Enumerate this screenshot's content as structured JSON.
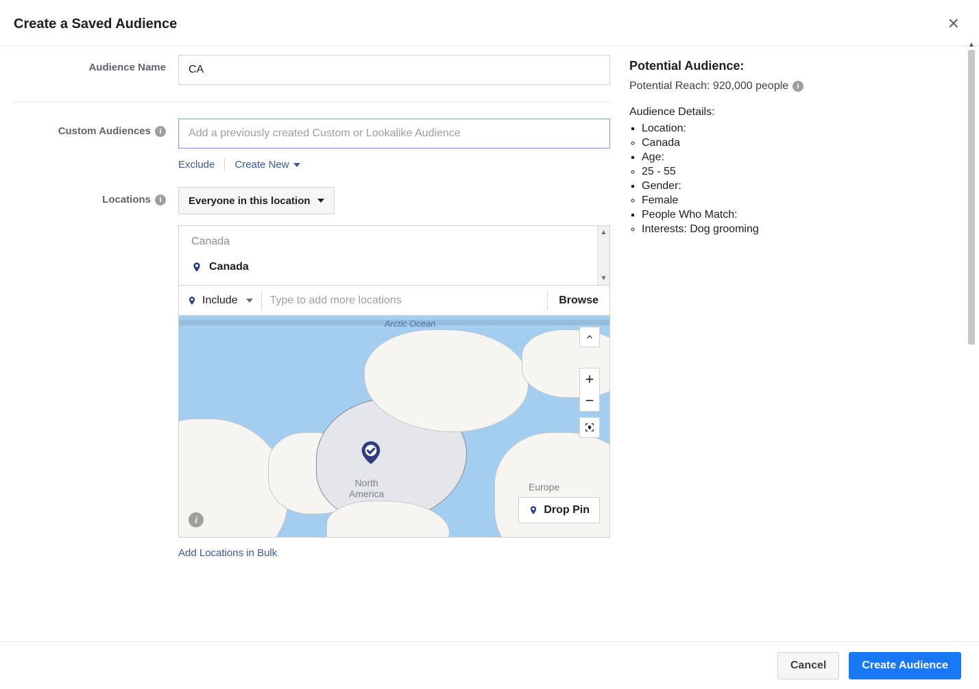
{
  "header": {
    "title": "Create a Saved Audience"
  },
  "labels": {
    "audience_name": "Audience Name",
    "custom_audiences": "Custom Audiences",
    "locations": "Locations"
  },
  "audience_name": {
    "value": "CA"
  },
  "custom_audiences": {
    "placeholder": "Add a previously created Custom or Lookalike Audience",
    "exclude": "Exclude",
    "create_new": "Create New"
  },
  "locations": {
    "selector": "Everyone in this location",
    "input_hint": "Canada",
    "selected_country": "Canada",
    "include_label": "Include",
    "add_more_placeholder": "Type to add more locations",
    "browse": "Browse",
    "drop_pin": "Drop Pin",
    "bulk": "Add Locations in Bulk"
  },
  "map": {
    "ocean_label": "Arctic Ocean",
    "continent1": "North\nAmerica",
    "continent2": "Europe"
  },
  "potential": {
    "title": "Potential Audience:",
    "reach": "Potential Reach: 920,000 people",
    "details_heading": "Audience Details:",
    "items": [
      {
        "style": "sq",
        "text": "Location:"
      },
      {
        "style": "ci",
        "text": "Canada"
      },
      {
        "style": "sq",
        "text": "Age:"
      },
      {
        "style": "ci",
        "text": "25 - 55"
      },
      {
        "style": "sq",
        "text": "Gender:"
      },
      {
        "style": "ci",
        "text": "Female"
      },
      {
        "style": "sq",
        "text": "People Who Match:"
      },
      {
        "style": "ci",
        "text": "Interests: Dog grooming"
      }
    ]
  },
  "footer": {
    "cancel": "Cancel",
    "create": "Create Audience"
  }
}
